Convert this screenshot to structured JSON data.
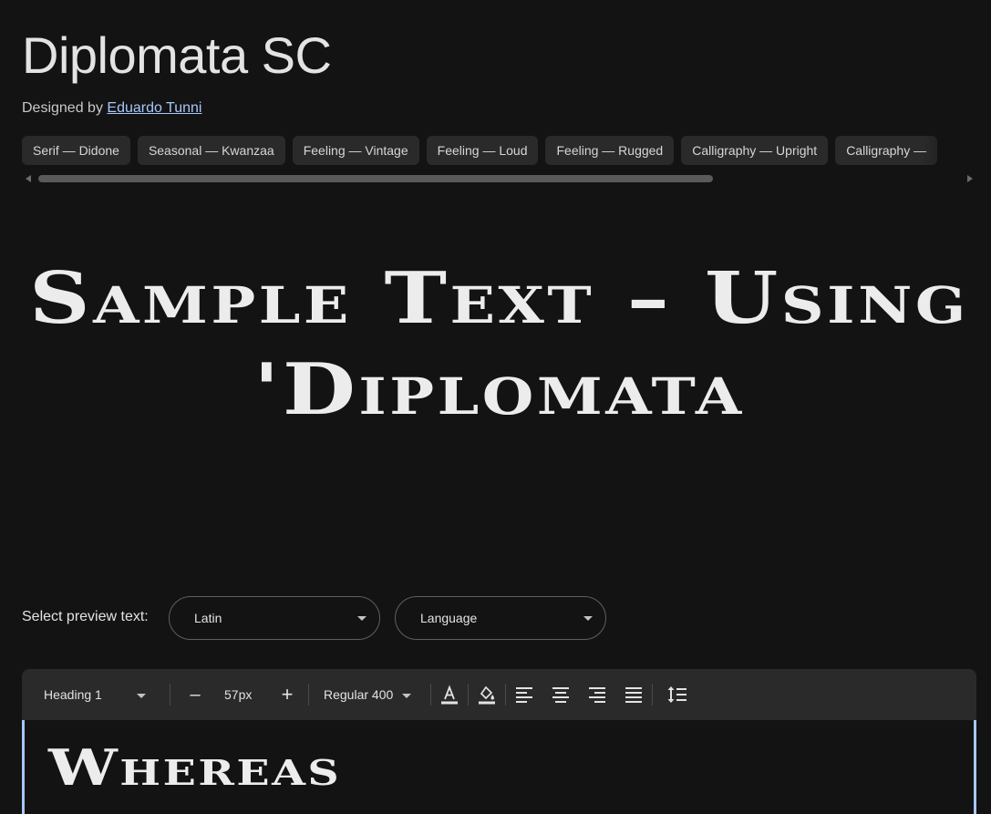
{
  "font": {
    "name": "Diplomata SC",
    "designed_by_label": "Designed by",
    "designer": "Eduardo Tunni"
  },
  "tags": [
    "Serif — Didone",
    "Seasonal — Kwanzaa",
    "Feeling — Vintage",
    "Feeling — Loud",
    "Feeling — Rugged",
    "Calligraphy — Upright",
    "Calligraphy —"
  ],
  "sample_text": "Sample Text – Using 'Diplomata",
  "preview": {
    "label": "Select preview text:",
    "script_value": "Latin",
    "language_value": "Language"
  },
  "toolbar": {
    "style_value": "Heading 1",
    "minus": "–",
    "size_value": "57px",
    "plus": "+",
    "weight_value": "Regular 400"
  },
  "editor": {
    "text": "Whereas"
  },
  "colors": {
    "background": "#131313",
    "link": "#a8c7fa",
    "chip": "#2a2a2a"
  }
}
